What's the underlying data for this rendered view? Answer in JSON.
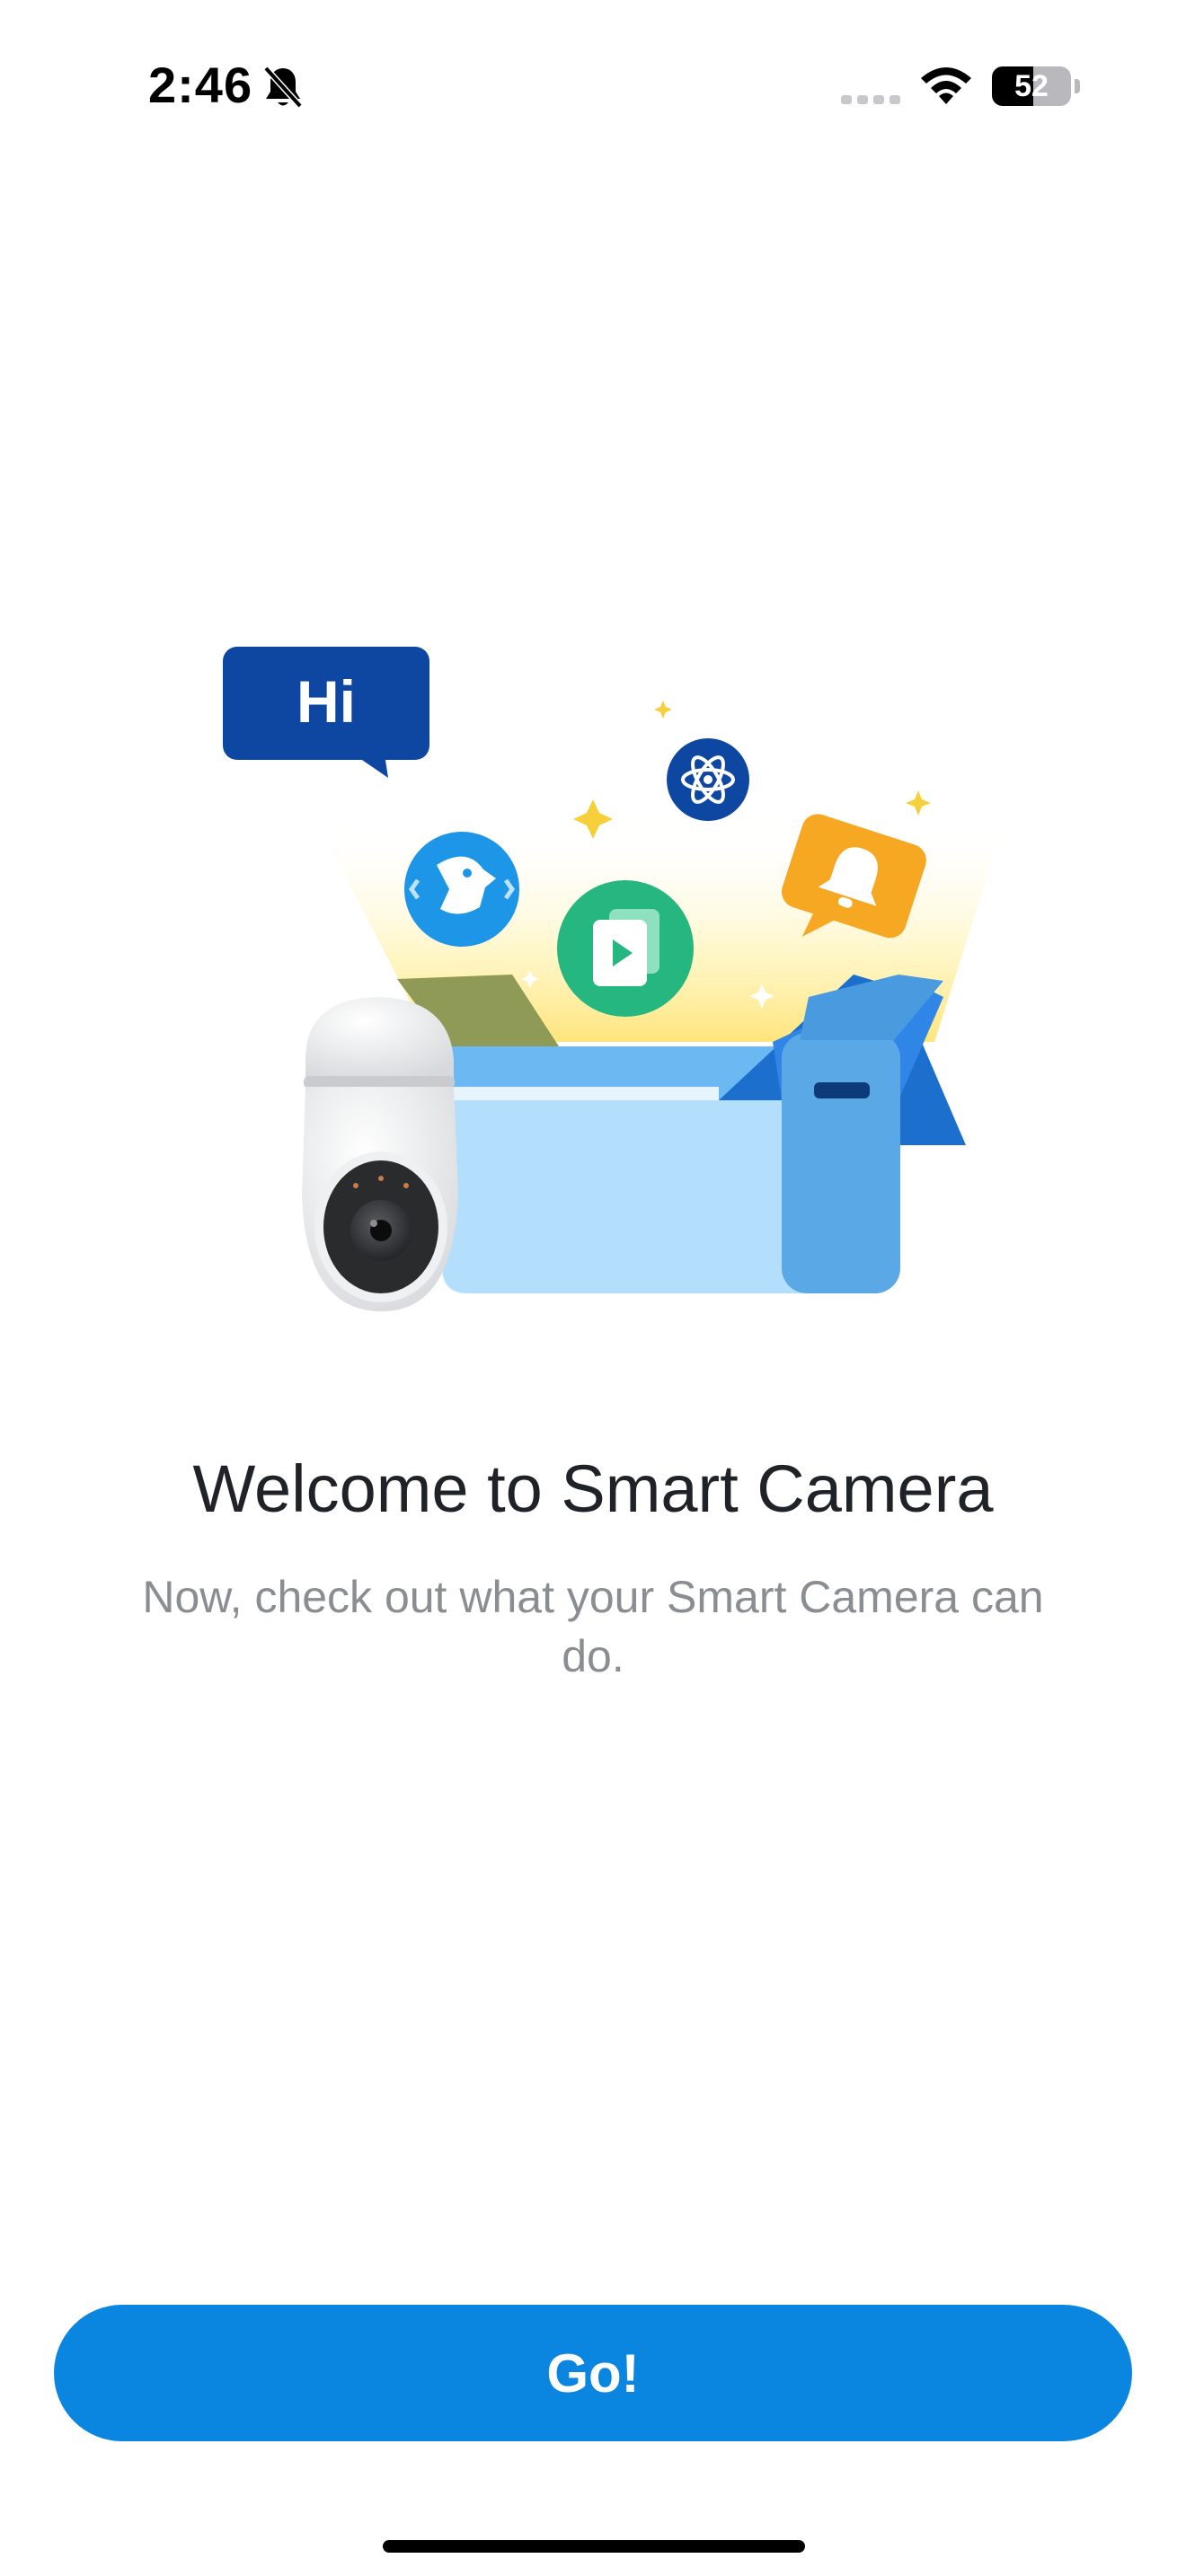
{
  "status_bar": {
    "time": "2:46",
    "battery_level": "52",
    "battery_percent": 52,
    "icons": [
      "bell-off-icon",
      "signal-icon",
      "wifi-icon",
      "battery-icon"
    ]
  },
  "illustration": {
    "speech_bubble_text": "Hi",
    "icons": [
      "speech-bubble-icon",
      "ai-bot-icon",
      "video-playlist-icon",
      "atom-icon",
      "notification-bell-icon",
      "security-camera",
      "open-box"
    ]
  },
  "welcome": {
    "title": "Welcome to Smart Camera",
    "subtitle": "Now, check out what your Smart Camera can do."
  },
  "actions": {
    "go_label": "Go!"
  },
  "colors": {
    "accent": "#0a86e0",
    "bubble": "#0d47a1",
    "box_light": "#b3dffc",
    "box_mid": "#64b5f6",
    "green": "#26b67f",
    "orange": "#f7a823",
    "title_text": "#1f2328",
    "subtitle_text": "#8a8d91"
  }
}
